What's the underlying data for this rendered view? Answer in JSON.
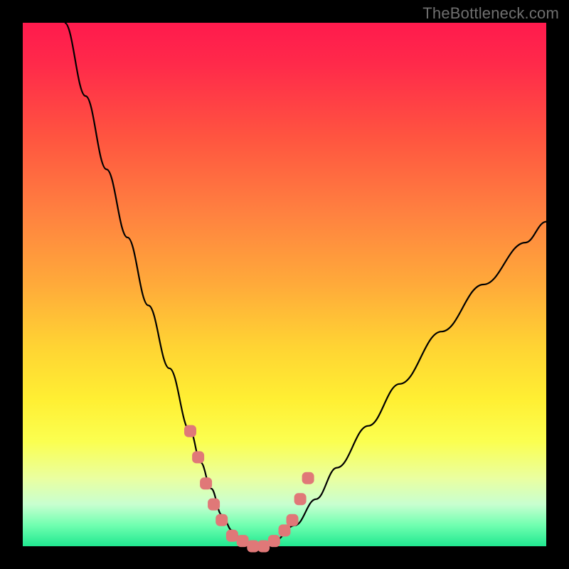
{
  "watermark": {
    "text": "TheBottleneck.com"
  },
  "colors": {
    "frame": "#000000",
    "curve": "#000000",
    "marker": "#e07878",
    "gradient_top": "#ff1a4d",
    "gradient_bottom": "#20e890"
  },
  "chart_data": {
    "type": "line",
    "title": "",
    "xlabel": "",
    "ylabel": "",
    "xlim": [
      0,
      100
    ],
    "ylim": [
      0,
      100
    ],
    "grid": false,
    "legend": false,
    "series": [
      {
        "name": "bottleneck-curve",
        "x": [
          8,
          12,
          16,
          20,
          24,
          28,
          32,
          34,
          36,
          38,
          40,
          42,
          44,
          46,
          48,
          52,
          56,
          60,
          66,
          72,
          80,
          88,
          96,
          100
        ],
        "values": [
          100,
          86,
          72,
          59,
          46,
          34,
          22,
          16,
          11,
          6,
          3,
          1,
          0,
          0,
          1,
          4,
          9,
          15,
          23,
          31,
          41,
          50,
          58,
          62
        ]
      }
    ],
    "markers": [
      {
        "x": 32.0,
        "y": 22
      },
      {
        "x": 33.5,
        "y": 17
      },
      {
        "x": 35.0,
        "y": 12
      },
      {
        "x": 36.5,
        "y": 8
      },
      {
        "x": 38.0,
        "y": 5
      },
      {
        "x": 40.0,
        "y": 2
      },
      {
        "x": 42.0,
        "y": 1
      },
      {
        "x": 44.0,
        "y": 0
      },
      {
        "x": 46.0,
        "y": 0
      },
      {
        "x": 48.0,
        "y": 1
      },
      {
        "x": 50.0,
        "y": 3
      },
      {
        "x": 51.5,
        "y": 5
      },
      {
        "x": 53.0,
        "y": 9
      },
      {
        "x": 54.5,
        "y": 13
      }
    ]
  }
}
